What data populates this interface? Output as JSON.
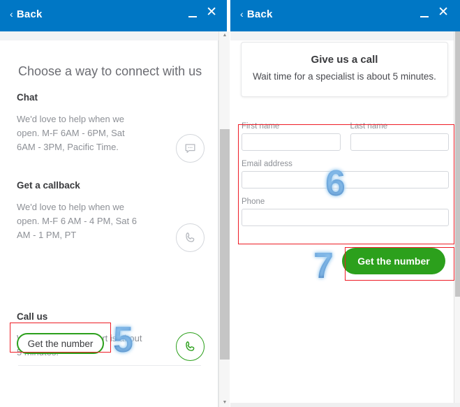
{
  "left_window": {
    "titlebar": {
      "back_label": "Back",
      "back_chevron": "‹",
      "minimize_icon": "minimize-icon",
      "close_icon": "✕"
    },
    "heading": "Choose a way to connect with us",
    "options": [
      {
        "title": "Chat",
        "description": "We'd love to help when we open. M-F 6AM - 6PM, Sat 6AM - 3PM, Pacific Time.",
        "icon": "chat-bubble-icon",
        "icon_color": "#b6b9bf"
      },
      {
        "title": "Get a callback",
        "description": "We'd love to help when we open. M-F 6 AM - 4 PM, Sat 6 AM - 1 PM, PT",
        "icon": "phone-icon",
        "icon_color": "#b6b9bf"
      },
      {
        "title": "Call us",
        "description": "Wait time for an expert is about 5 minutes.",
        "icon": "phone-icon",
        "icon_color": "#2ca01c"
      }
    ],
    "get_number_button": "Get the number"
  },
  "right_window": {
    "titlebar": {
      "back_label": "Back",
      "back_chevron": "‹",
      "minimize_icon": "minimize-icon",
      "close_icon": "✕"
    },
    "card": {
      "title": "Give us a call",
      "subtitle": "Wait time for a specialist is about 5 minutes."
    },
    "form": {
      "first_name": {
        "label": "First name",
        "value": ""
      },
      "last_name": {
        "label": "Last name",
        "value": ""
      },
      "email": {
        "label": "Email address",
        "value": ""
      },
      "phone": {
        "label": "Phone",
        "value": ""
      }
    },
    "submit_button": "Get the number"
  },
  "annotations": {
    "step5": "5",
    "step6": "6",
    "step7": "7",
    "box_color": "#ee1c25",
    "number_color": "#2f73bf"
  }
}
